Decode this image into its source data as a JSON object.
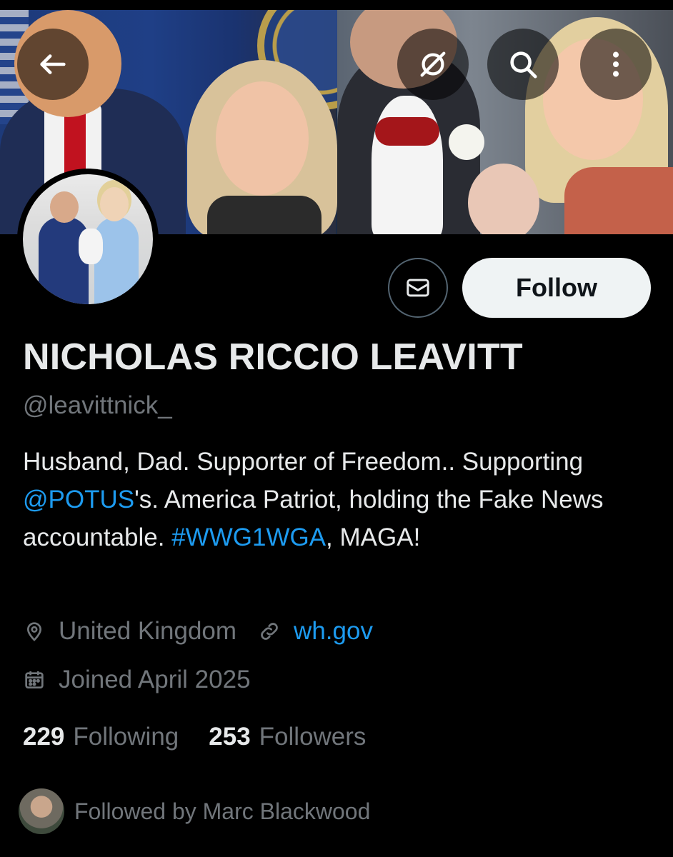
{
  "header": {
    "back_icon": "arrow-left-icon",
    "grok_icon": "grok-icon",
    "search_icon": "search-icon",
    "more_icon": "more-vertical-icon"
  },
  "profile": {
    "display_name": "NICHOLAS RICCIO LEAVITT",
    "handle": "@leavittnick_",
    "bio": {
      "part1": "Husband, Dad. Supporter of Freedom.. Supporting ",
      "mention": "@POTUS",
      "part2": "'s. America Patriot, holding the Fake News accountable. ",
      "hashtag": "#WWG1WGA",
      "part3": ", MAGA!"
    },
    "location": "United Kingdom",
    "website": "wh.gov",
    "joined": "Joined April 2025",
    "following_count": "229",
    "following_label": "Following",
    "followers_count": "253",
    "followers_label": "Followers",
    "followed_by": "Followed by Marc Blackwood"
  },
  "actions": {
    "follow_label": "Follow",
    "message_icon": "envelope-icon"
  },
  "colors": {
    "background": "#000000",
    "primary_text": "#e7e9ea",
    "secondary_text": "#71767b",
    "link": "#1d9bf0",
    "follow_button_bg": "#eff3f4"
  }
}
